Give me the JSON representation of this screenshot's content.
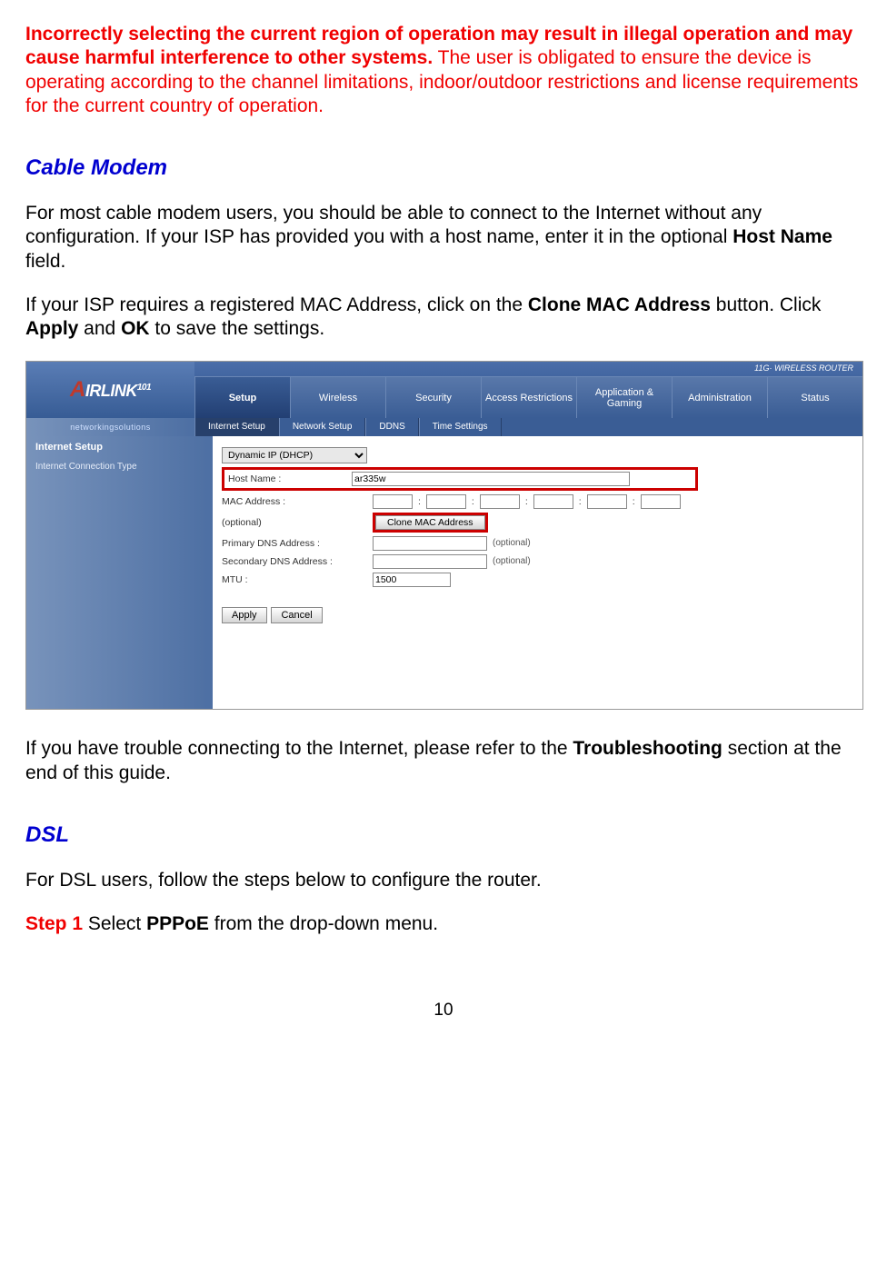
{
  "warning": {
    "bold": "Incorrectly selecting the current region of operation may result in illegal operation and may cause harmful interference to other systems.",
    "rest": " The user is obligated to ensure the device is operating according to the channel limitations, indoor/outdoor restrictions and license requirements for the current country of operation."
  },
  "sections": {
    "cable_modem": {
      "heading": "Cable Modem",
      "p1_a": "For most cable modem users, you should be able to connect to the Internet without any configuration. If your ISP has provided you with a host name, enter it in the optional ",
      "p1_b": "Host Name",
      "p1_c": " field.",
      "p2_a": "If your ISP requires a registered MAC Address, click on the ",
      "p2_b": "Clone MAC Address",
      "p2_c": " button. Click ",
      "p2_d": "Apply",
      "p2_e": " and ",
      "p2_f": "OK",
      "p2_g": " to save the settings.",
      "p3_a": "If you have trouble connecting to the Internet, please refer to the ",
      "p3_b": "Troubleshooting",
      "p3_c": " section at the end of this guide."
    },
    "dsl": {
      "heading": "DSL",
      "p1": "For DSL users, follow the steps below to configure the router.",
      "step1_label": "Step 1",
      "step1_a": " Select ",
      "step1_b": "PPPoE",
      "step1_c": " from the drop-down menu."
    }
  },
  "router": {
    "brand_a": "A",
    "brand_rest": "IRLINK",
    "brand_suffix": "101",
    "brand_sub": "networkingsolutions",
    "product": "11G· WIRELESS ROUTER",
    "main_tabs": [
      "Setup",
      "Wireless",
      "Security",
      "Access Restrictions",
      "Application & Gaming",
      "Administration",
      "Status"
    ],
    "sub_tabs": [
      "Internet Setup",
      "Network Setup",
      "DDNS",
      "Time Settings"
    ],
    "side": {
      "title": "Internet Setup",
      "label": "Internet Connection Type"
    },
    "form": {
      "conn_type": "Dynamic IP (DHCP)",
      "hostname_label": "Host Name :",
      "hostname_value": "ar335w",
      "mac_label": "MAC Address :",
      "mac_sep": ":",
      "optional": "(optional)",
      "clone_btn": "Clone MAC Address",
      "pri_dns_label": "Primary DNS Address :",
      "sec_dns_label": "Secondary DNS Address :",
      "mtu_label": "MTU :",
      "mtu_value": "1500",
      "apply": "Apply",
      "cancel": "Cancel"
    }
  },
  "page_number": "10"
}
